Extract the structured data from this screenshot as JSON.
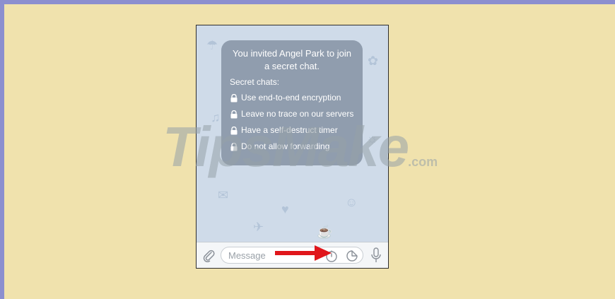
{
  "chat": {
    "invite_title": "You invited Angel Park to join a secret chat.",
    "section_label": "Secret chats:",
    "features": [
      "Use end-to-end encryption",
      "Leave no trace on our servers",
      "Have a self-destruct timer",
      "Do not allow forwarding"
    ]
  },
  "input": {
    "placeholder": "Message"
  },
  "icons": {
    "attach": "paperclip-icon",
    "timer": "self-destruct-timer-icon",
    "sticker": "sticker-icon",
    "mic": "microphone-icon",
    "lock": "lock-icon",
    "annotation": "red-arrow-icon"
  },
  "watermark": {
    "brand": "TipsMake",
    "suffix": ".com"
  },
  "colors": {
    "page_bg": "#f0e2ad",
    "frame": "#8c8fcf",
    "bubble": "#7d8c9e",
    "arrow": "#e0161b"
  }
}
